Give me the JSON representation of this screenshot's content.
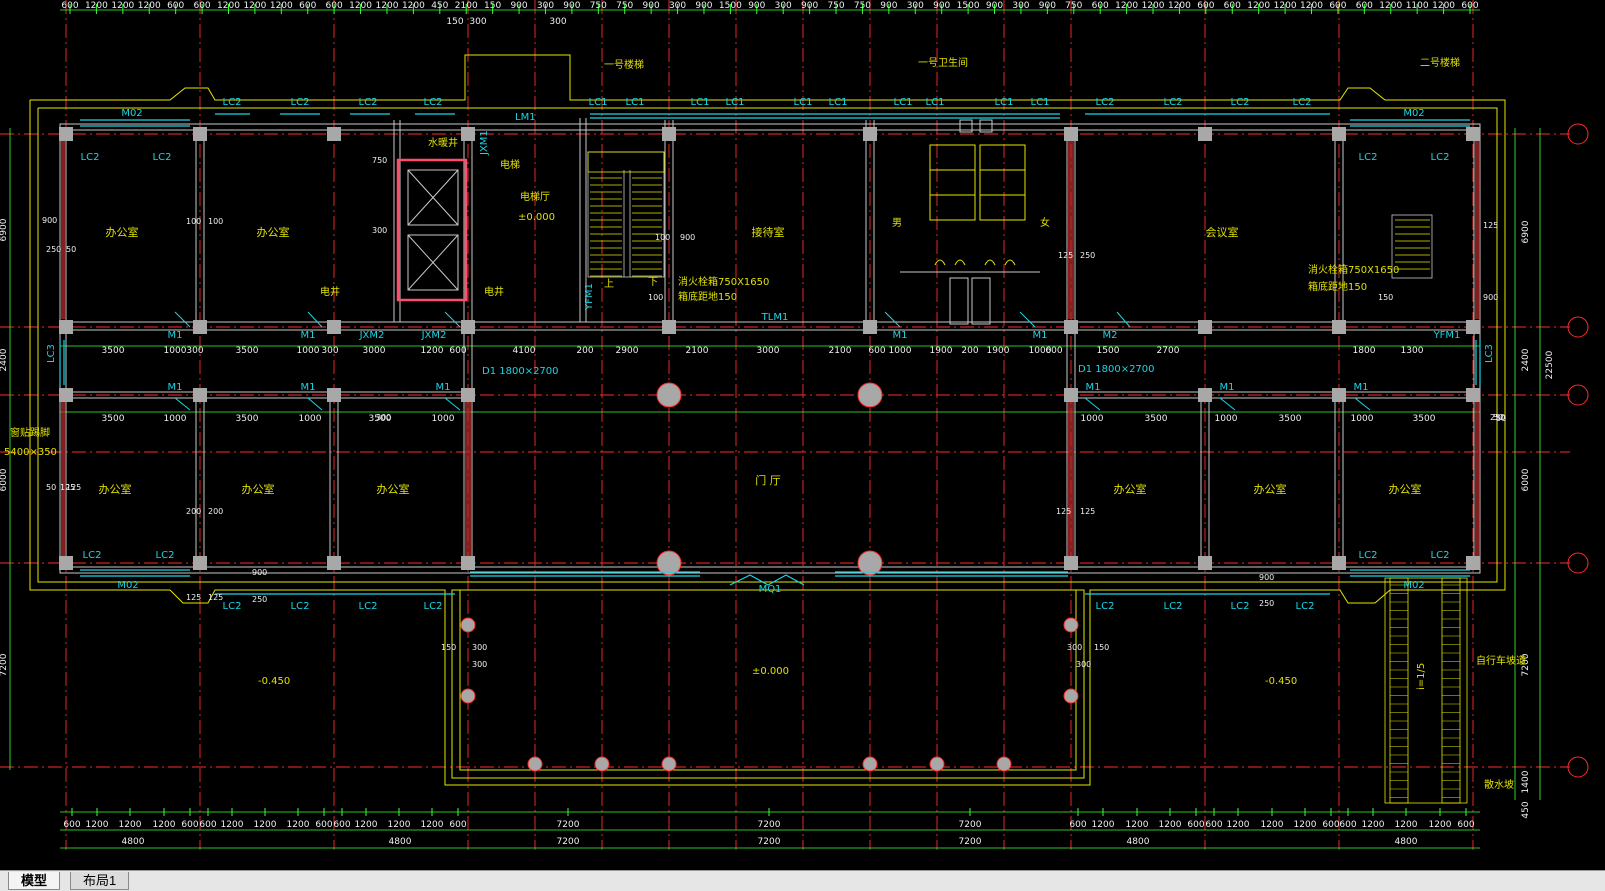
{
  "colors": {
    "background": "#000000",
    "axis": "#ff2a2a",
    "dimension": "#3cff3c",
    "wall": "#c8c8c8",
    "column": "#a8a8a8",
    "window": "#19d6e6",
    "label": "#19d6e6",
    "room_text": "#e0e000",
    "outline": "#e6e600"
  },
  "top_dims_row1": [
    "600",
    "1200",
    "1200",
    "1200",
    "600",
    "600",
    "1200",
    "1200",
    "1200",
    "600",
    "600",
    "1200",
    "1200",
    "1200",
    "450",
    "2100",
    "150",
    "900",
    "300",
    "900",
    "750",
    "750",
    "900",
    "300",
    "900",
    "1500",
    "900",
    "300",
    "900",
    "750",
    "750",
    "900",
    "300",
    "900",
    "1500",
    "900",
    "300",
    "900",
    "750",
    "600",
    "1200",
    "1200",
    "1200",
    "600",
    "600",
    "1200",
    "1200",
    "1200",
    "600",
    "600",
    "1200",
    "1100",
    "1200",
    "600"
  ],
  "top_dims_row2": [
    "150",
    "300",
    "300"
  ],
  "bottom_dims_row1": [
    "600",
    "1200",
    "1200",
    "1200",
    "600",
    "600",
    "1200",
    "1200",
    "1200",
    "600",
    "600",
    "1200",
    "1200",
    "1200",
    "600",
    "7200",
    "7200",
    "7200",
    "600",
    "1200",
    "1200",
    "1200",
    "600",
    "600",
    "1200",
    "1200",
    "1200",
    "600",
    "600",
    "1200",
    "1200",
    "1200",
    "600"
  ],
  "bottom_dims_row2": [
    "4800",
    "4800",
    "7200",
    "7200",
    "7200",
    "4800",
    "4800"
  ],
  "left_dims": [
    "6900",
    "2400",
    "6000",
    "7200"
  ],
  "right_dims": [
    "6900",
    "2400",
    "22500",
    "6000",
    "7200",
    "1400",
    "450"
  ],
  "mid_row_dims": [
    "3500",
    "1000",
    "300",
    "3500",
    "1000",
    "300",
    "3000",
    "1200",
    "600",
    "4100",
    "200",
    "2900",
    "2100",
    "3000",
    "2100",
    "600",
    "1000",
    "1900",
    "200",
    "1900",
    "1000",
    "600",
    "1500",
    "2700",
    "1800",
    "1300"
  ],
  "row_b_dims": [
    "3500",
    "1000",
    "3500",
    "1000",
    "3500",
    "1000",
    "1000",
    "3500",
    "1000",
    "3500",
    "1000",
    "3500"
  ],
  "windows_top": [
    "M02",
    "LC2",
    "LC2",
    "LC2",
    "LC2",
    "LC1",
    "LC1",
    "LC1",
    "LC1",
    "LC1",
    "LC1",
    "LC1",
    "LC1",
    "LC1",
    "LC1",
    "LC2",
    "LC2",
    "LC2",
    "LC2",
    "M02"
  ],
  "windows_bottom": [
    "M02",
    "LC2",
    "LC2",
    "LC2",
    "LC2",
    "MQ1",
    "LC2",
    "LC2",
    "LC2",
    "LC2",
    "M02"
  ],
  "doors_mid": [
    "M1",
    "M1",
    "JXM2",
    "JXM2",
    "TLM1",
    "M1",
    "M1",
    "M2",
    "YFM1"
  ],
  "doors_lower": [
    "M1",
    "M1",
    "M1",
    "M1",
    "M1",
    "M1"
  ],
  "rooms": [
    "办公室",
    "办公室",
    "接待室",
    "会议室",
    "办公室",
    "办公室",
    "办公室",
    "门 厅",
    "办公室",
    "办公室",
    "办公室"
  ],
  "elevator_labels": [
    "水暖井",
    "电梯",
    "电梯厅",
    "电井",
    "电井",
    "JXM1",
    "YFM1",
    "LM1",
    "LC3",
    "LC3"
  ],
  "annotations": {
    "stair1": "一号楼梯",
    "toilet": "一号卫生间",
    "stair2": "二号楼梯",
    "fire_hydrant1": "消火栓箱750X1650",
    "fire_hydrant1b": "箱底距地150",
    "fire_hydrant2": "消火栓箱750X1650",
    "fire_hydrant2b": "箱底距地150",
    "opening1": "D1 1800×2700",
    "opening2": "D1 1800×2700",
    "elev0": "±0.000",
    "elev1": "±0.000",
    "elev_left": "-0.450",
    "elev_right": "-0.450",
    "ramp": "自行车坡道",
    "ramp_slope": "i=1/5",
    "scupper": "散水坡",
    "left_note": "窗贴踢脚",
    "left_note2": "5400×350",
    "wc_m": "男",
    "wc_f": "女",
    "stair_down": "下",
    "stair_up": "上"
  },
  "misc_dims": [
    "900",
    "250",
    "50",
    "100",
    "100",
    "125",
    "125",
    "200",
    "200",
    "750",
    "300",
    "100",
    "100",
    "900",
    "125",
    "125",
    "250",
    "50",
    "125",
    "125",
    "900",
    "50",
    "300",
    "150",
    "150",
    "300",
    "300",
    "150",
    "300",
    "300",
    "900",
    "250",
    "50",
    "250",
    "125",
    "125",
    "900",
    "250"
  ],
  "tabs": [
    "模型",
    "布局1"
  ],
  "active_tab": "模型"
}
